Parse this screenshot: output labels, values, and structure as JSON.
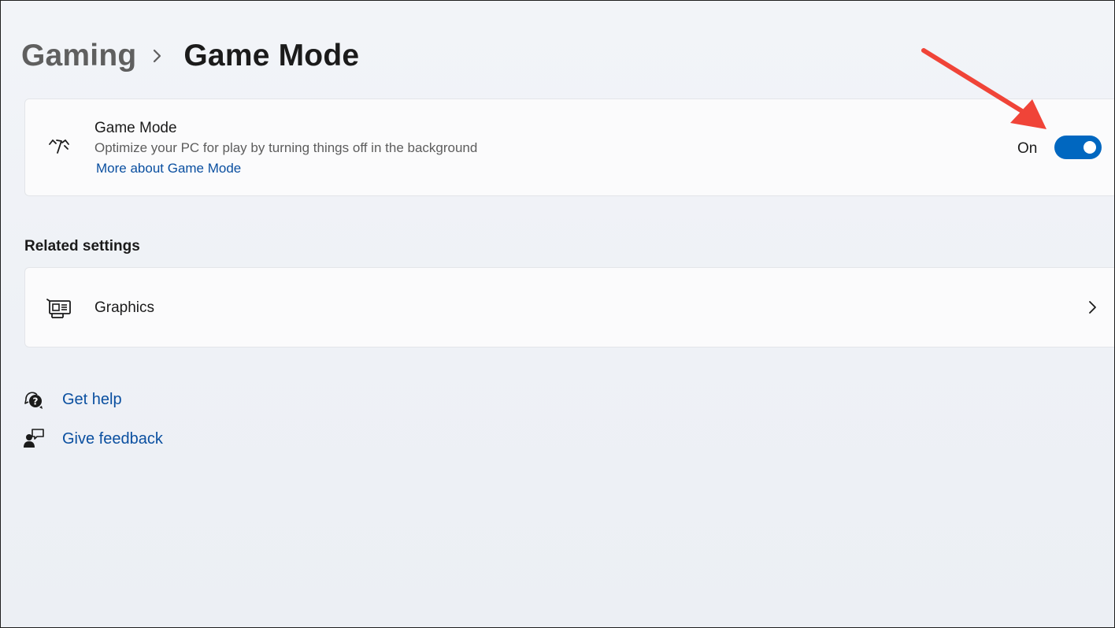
{
  "breadcrumb": {
    "parent": "Gaming",
    "current": "Game Mode"
  },
  "game_mode": {
    "icon": "game-mode-gauge-icon",
    "title": "Game Mode",
    "description": "Optimize your PC for play by turning things off in the background",
    "link": "More about Game Mode",
    "toggle_state_label": "On",
    "toggle_on": true
  },
  "related_settings": {
    "heading": "Related settings",
    "items": [
      {
        "label": "Graphics",
        "icon": "graphics-card-icon"
      }
    ]
  },
  "help_links": [
    {
      "label": "Get help",
      "icon": "get-help-icon"
    },
    {
      "label": "Give feedback",
      "icon": "give-feedback-icon"
    }
  ],
  "colors": {
    "accent": "#0067c0",
    "link": "#0a4fa0",
    "annotation_arrow": "#f04438"
  }
}
